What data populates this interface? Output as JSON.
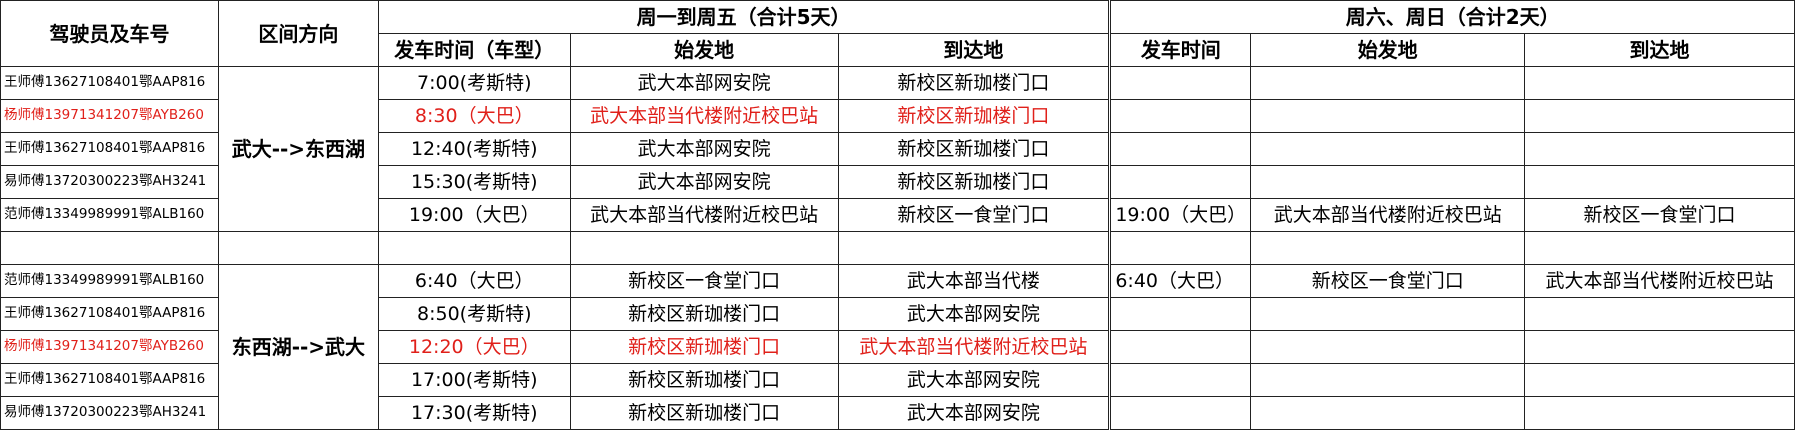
{
  "header": {
    "driver": "驾驶员及车号",
    "direction": "区间方向",
    "weekday": "周一到周五（合计5天）",
    "weekend": "周六、周日（合计2天）",
    "wd_time": "发车时间（车型）",
    "wd_from": "始发地",
    "wd_to": "到达地",
    "we_time": "发车时间",
    "we_from": "始发地",
    "we_to": "到达地"
  },
  "group1": {
    "direction": "武大-->东西湖",
    "rows": [
      {
        "driver": "王师傅13627108401鄂AAP816",
        "time": "7:00(考斯特)",
        "from": "武大本部网安院",
        "to": "新校区新珈楼门口",
        "we_time": "",
        "we_from": "",
        "we_to": ""
      },
      {
        "driver": "杨师傅13971341207鄂AYB260",
        "time": "8:30（大巴）",
        "from": "武大本部当代楼附近校巴站",
        "to": "新校区新珈楼门口",
        "we_time": "",
        "we_from": "",
        "we_to": ""
      },
      {
        "driver": "王师傅13627108401鄂AAP816",
        "time": "12:40(考斯特)",
        "from": "武大本部网安院",
        "to": "新校区新珈楼门口",
        "we_time": "",
        "we_from": "",
        "we_to": ""
      },
      {
        "driver": "易师傅13720300223鄂AH3241",
        "time": "15:30(考斯特)",
        "from": "武大本部网安院",
        "to": "新校区新珈楼门口",
        "we_time": "",
        "we_from": "",
        "we_to": ""
      },
      {
        "driver": "范师傅13349989991鄂ALB160",
        "time": "19:00（大巴）",
        "from": "武大本部当代楼附近校巴站",
        "to": "新校区一食堂门口",
        "we_time": "19:00（大巴）",
        "we_from": "武大本部当代楼附近校巴站",
        "we_to": "新校区一食堂门口"
      }
    ]
  },
  "group2": {
    "direction": "东西湖-->武大",
    "rows": [
      {
        "driver": "范师傅13349989991鄂ALB160",
        "time": "6:40（大巴）",
        "from": "新校区一食堂门口",
        "to": "武大本部当代楼",
        "we_time": "6:40（大巴）",
        "we_from": "新校区一食堂门口",
        "we_to": "武大本部当代楼附近校巴站"
      },
      {
        "driver": "王师傅13627108401鄂AAP816",
        "time": "8:50(考斯特)",
        "from": "新校区新珈楼门口",
        "to": "武大本部网安院",
        "we_time": "",
        "we_from": "",
        "we_to": ""
      },
      {
        "driver": "杨师傅13971341207鄂AYB260",
        "time": "12:20（大巴）",
        "from": "新校区新珈楼门口",
        "to": "武大本部当代楼附近校巴站",
        "we_time": "",
        "we_from": "",
        "we_to": ""
      },
      {
        "driver": "王师傅13627108401鄂AAP816",
        "time": "17:00(考斯特)",
        "from": "新校区新珈楼门口",
        "to": "武大本部网安院",
        "we_time": "",
        "we_from": "",
        "we_to": ""
      },
      {
        "driver": "易师傅13720300223鄂AH3241",
        "time": "17:30(考斯特)",
        "from": "新校区新珈楼门口",
        "to": "武大本部网安院",
        "we_time": "",
        "we_from": "",
        "we_to": ""
      }
    ]
  },
  "colors": {
    "highlight": "#e0201a",
    "border": "#222222"
  }
}
